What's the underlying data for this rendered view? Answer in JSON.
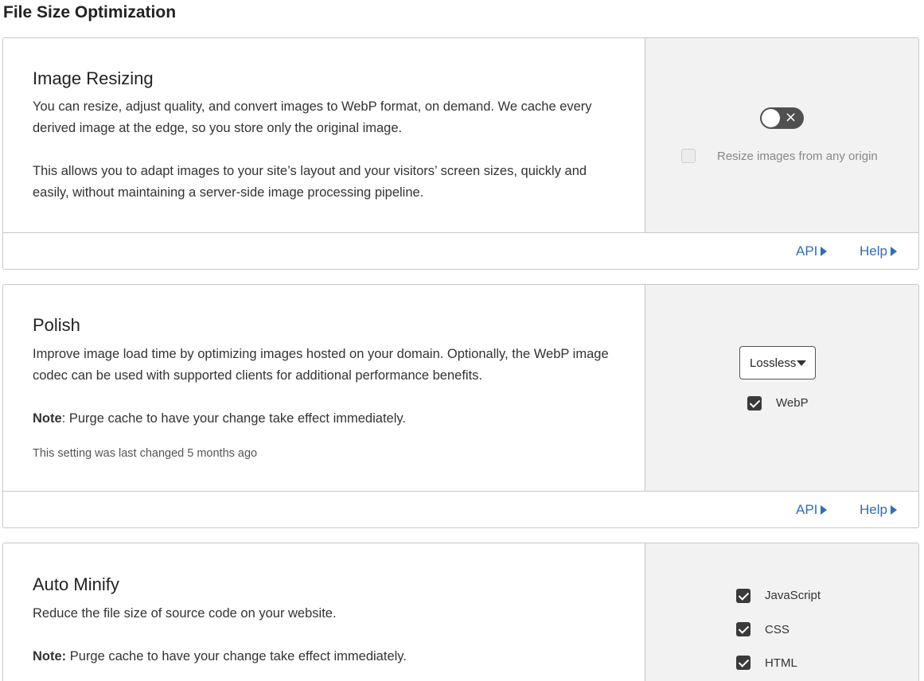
{
  "page": {
    "title": "File Size Optimization"
  },
  "image_resizing": {
    "title": "Image Resizing",
    "paragraph1": "You can resize, adjust quality, and convert images to WebP format, on demand. We cache every derived image at the edge, so you store only the original image.",
    "paragraph2": "This allows you to adapt images to your site’s layout and your visitors’ screen sizes, quickly and easily, without maintaining a server-side image processing pipeline.",
    "toggle_state": "off",
    "checkbox_label": "Resize images from any origin",
    "checkbox_checked": false,
    "api_link": "API",
    "help_link": "Help"
  },
  "polish": {
    "title": "Polish",
    "description": "Improve image load time by optimizing images hosted on your domain. Optionally, the WebP image codec can be used with supported clients for additional performance benefits.",
    "note_label": "Note",
    "note_text": ": Purge cache to have your change take effect immediately.",
    "last_changed": "This setting was last changed 5 months ago",
    "select_value": "Lossless",
    "webp_label": "WebP",
    "webp_checked": true,
    "api_link": "API",
    "help_link": "Help"
  },
  "auto_minify": {
    "title": "Auto Minify",
    "description": "Reduce the file size of source code on your website.",
    "note_label": "Note:",
    "note_text": " Purge cache to have your change take effect immediately.",
    "options": [
      {
        "label": "JavaScript",
        "checked": true
      },
      {
        "label": "CSS",
        "checked": true
      },
      {
        "label": "HTML",
        "checked": true
      }
    ]
  },
  "colors": {
    "link": "#2f6eb8",
    "side_panel": "#f2f2f2",
    "toggle_off": "#505050"
  }
}
